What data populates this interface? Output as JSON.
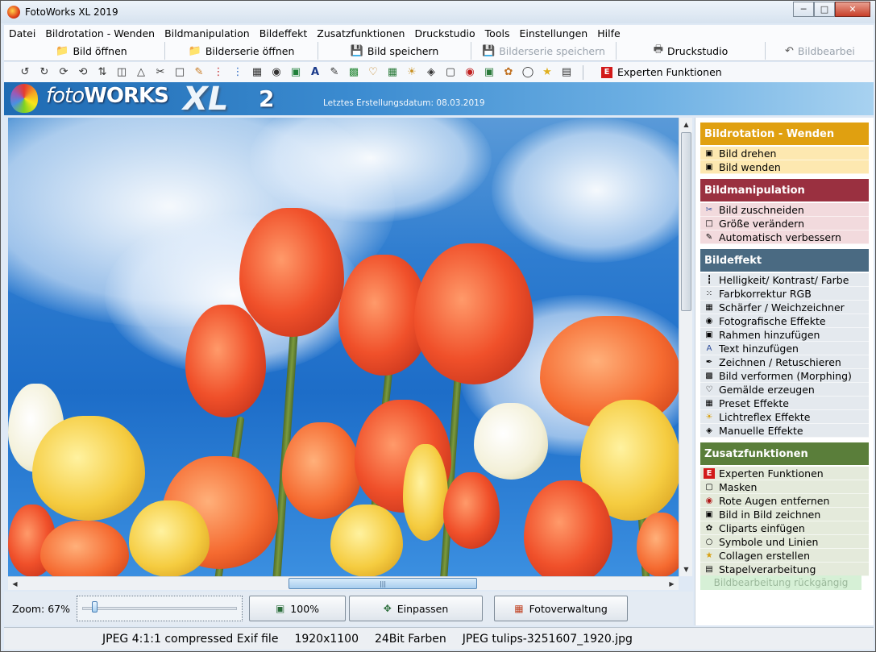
{
  "window": {
    "title": "FotoWorks XL 2019",
    "controls": {
      "minimize": "─",
      "maximize": "□",
      "close": "✕"
    }
  },
  "menu": [
    "Datei",
    "Bildrotation - Wenden",
    "Bildmanipulation",
    "Bildeffekt",
    "Zusatzfunktionen",
    "Druckstudio",
    "Tools",
    "Einstellungen",
    "Hilfe"
  ],
  "toolbar1": [
    {
      "label": "Bild öffnen",
      "icon": "folder-icon",
      "enabled": true
    },
    {
      "label": "Bilderserie öffnen",
      "icon": "folder-icon",
      "enabled": true
    },
    {
      "label": "Bild speichern",
      "icon": "save-icon",
      "enabled": true
    },
    {
      "label": "Bilderserie speichern",
      "icon": "save-icon",
      "enabled": false
    },
    {
      "label": "Druckstudio",
      "icon": "printer-icon",
      "enabled": true
    },
    {
      "label": "Bildbearbei",
      "icon": "undo-icon",
      "enabled": false
    }
  ],
  "toolbar2": {
    "expert_label": "Experten Funktionen",
    "expert_icon": "E"
  },
  "banner": {
    "logo_foto": "foto",
    "logo_works": "WORKS",
    "logo_xl": "XL",
    "logo_version": "2",
    "build_date": "Letztes Erstellungsdatum: 08.03.2019"
  },
  "colors": {
    "section_rotation": "#e0a010",
    "section_manipulation": "#9a3040",
    "section_effect": "#4a6a82",
    "section_extra": "#5a7e3a",
    "item_rotation_bg": "#fde8b0",
    "item_manipulation_bg": "#f2dadd",
    "item_effect_bg": "#e4e9ee",
    "item_extra_bg": "#e4eadb"
  },
  "sidepanel": {
    "sections": [
      {
        "title": "Bildrotation - Wenden",
        "items": [
          "Bild drehen",
          "Bild wenden"
        ]
      },
      {
        "title": "Bildmanipulation",
        "items": [
          "Bild zuschneiden",
          "Größe verändern",
          "Automatisch verbessern"
        ]
      },
      {
        "title": "Bildeffekt",
        "items": [
          "Helligkeit/ Kontrast/ Farbe",
          "Farbkorrektur RGB",
          "Schärfer / Weichzeichner",
          "Fotografische Effekte",
          "Rahmen hinzufügen",
          "Text hinzufügen",
          "Zeichnen / Retuschieren",
          "Bild verformen (Morphing)",
          "Gemälde erzeugen",
          "Preset Effekte",
          "Lichtreflex Effekte",
          "Manuelle Effekte"
        ]
      },
      {
        "title": "Zusatzfunktionen",
        "items": [
          "Experten Funktionen",
          "Masken",
          "Rote Augen entfernen",
          "Bild in Bild zeichnen",
          "Cliparts einfügen",
          "Symbole und Linien",
          "Collagen erstellen",
          "Stapelverarbeitung"
        ]
      }
    ],
    "undo_label": "Bildbearbeitung rückgängig"
  },
  "bottom": {
    "zoom_label": "Zoom: 67%",
    "zoom_level": 0.06,
    "btn_100": "100%",
    "btn_fit": "Einpassen",
    "btn_manage": "Fotoverwaltung"
  },
  "status": {
    "format": "JPEG 4:1:1 compressed Exif file",
    "dimensions": "1920x1100",
    "colors": "24Bit Farben",
    "file": "JPEG tulips-3251607_1920.jpg"
  }
}
